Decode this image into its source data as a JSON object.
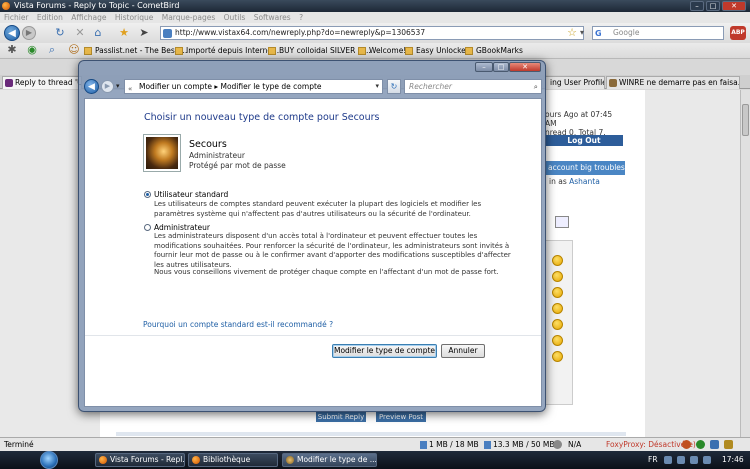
{
  "browser": {
    "title": "Vista Forums - Reply to Topic - CometBird",
    "menu": [
      "Fichier",
      "Edition",
      "Affichage",
      "Historique",
      "Marque-pages",
      "Outils",
      "Softwares",
      "?"
    ],
    "url": "http://www.vistax64.com/newreply.php?do=newreply&p=1306537",
    "search_placeholder": "Google",
    "abp_label": "ABP",
    "bookmarks": [
      "Passlist.net - The Best ...",
      "Importé depuis Interne...",
      "BUY colloidal SILVER G...",
      "Welcome!",
      "Easy Unlocker",
      "GBookMarks"
    ],
    "tabs": [
      "Reply to thread 'Us",
      "ing User Profile...",
      "WINRE ne demarre pas en faisa..."
    ]
  },
  "webpage": {
    "login_line1": "ours Ago at 07:45 AM",
    "login_line2": "nread 0, Total 7.",
    "logout": "Log Out",
    "thread_title": "account big troubles !",
    "logged_in_prefix": "in as",
    "logged_in_user": "Ashanta",
    "submit_reply": "Submit Reply",
    "preview_post": "Preview Post"
  },
  "dialog": {
    "crumb_1": "Modifier un compte",
    "crumb_2": "Modifier le type de compte",
    "crumb_sep": "▸",
    "search_placeholder": "Rechercher",
    "heading": "Choisir un nouveau type de compte pour Secours",
    "account": {
      "name": "Secours",
      "role": "Administrateur",
      "password_status": "Protégé par mot de passe"
    },
    "options": [
      {
        "label": "Utilisateur standard",
        "selected": true,
        "desc": "Les utilisateurs de comptes standard peuvent exécuter la plupart des logiciels et modifier les paramètres système qui n'affectent pas d'autres utilisateurs ou la sécurité de l'ordinateur."
      },
      {
        "label": "Administrateur",
        "selected": false,
        "desc": "Les administrateurs disposent d'un accès total à l'ordinateur et peuvent effectuer toutes les modifications souhaitées. Pour renforcer la sécurité de l'ordinateur, les administrateurs sont invités à fournir leur mot de passe ou à le confirmer avant d'apporter des modifications susceptibles d'affecter les autres utilisateurs."
      }
    ],
    "recommendation": "Nous vous conseillons vivement de protéger chaque compte en l'affectant d'un mot de passe fort.",
    "help_link": "Pourquoi un compte standard est-il recommandé ?",
    "change_button": "Modifier le type de compte",
    "cancel_button": "Annuler"
  },
  "statusbar": {
    "status": "Terminé",
    "mem1": "1 MB / 18 MB",
    "mem2": "13.3 MB / 50 MB",
    "na": "N/A",
    "foxyproxy": "FoxyProxy: Désactivé(e)"
  },
  "taskbar": {
    "buttons": [
      "Vista Forums - Repl...",
      "Bibliothèque",
      "Modifier le type de ..."
    ],
    "lang": "FR",
    "clock": "17:46"
  }
}
